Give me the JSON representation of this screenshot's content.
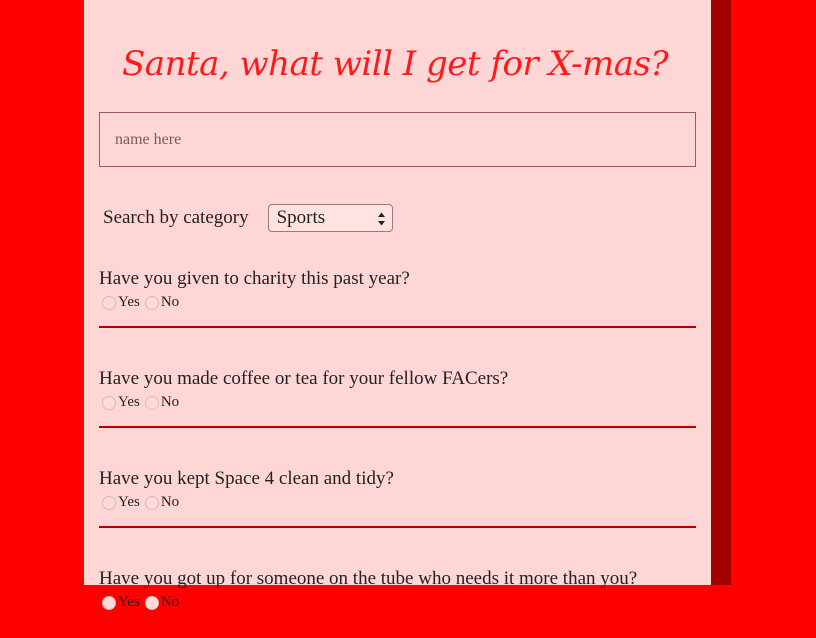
{
  "title": "Santa, what will I get for X-mas?",
  "name_input": {
    "placeholder": "name here",
    "value": ""
  },
  "category": {
    "label": "Search by category",
    "selected": "Sports"
  },
  "questions": [
    {
      "text": "Have you given to charity this past year?",
      "yes": "Yes",
      "no": "No"
    },
    {
      "text": "Have you made coffee or tea for your fellow FACers?",
      "yes": "Yes",
      "no": "No"
    },
    {
      "text": "Have you kept Space 4 clean and tidy?",
      "yes": "Yes",
      "no": "No"
    },
    {
      "text": "Have you got up for someone on the tube who needs it more than you?",
      "yes": "Yes",
      "no": "No"
    }
  ],
  "colors": {
    "background": "#ff0000",
    "card": "#ffd6d6",
    "title": "#ff1a1a",
    "divider": "#b30000",
    "card_shadow": "#a30000"
  }
}
